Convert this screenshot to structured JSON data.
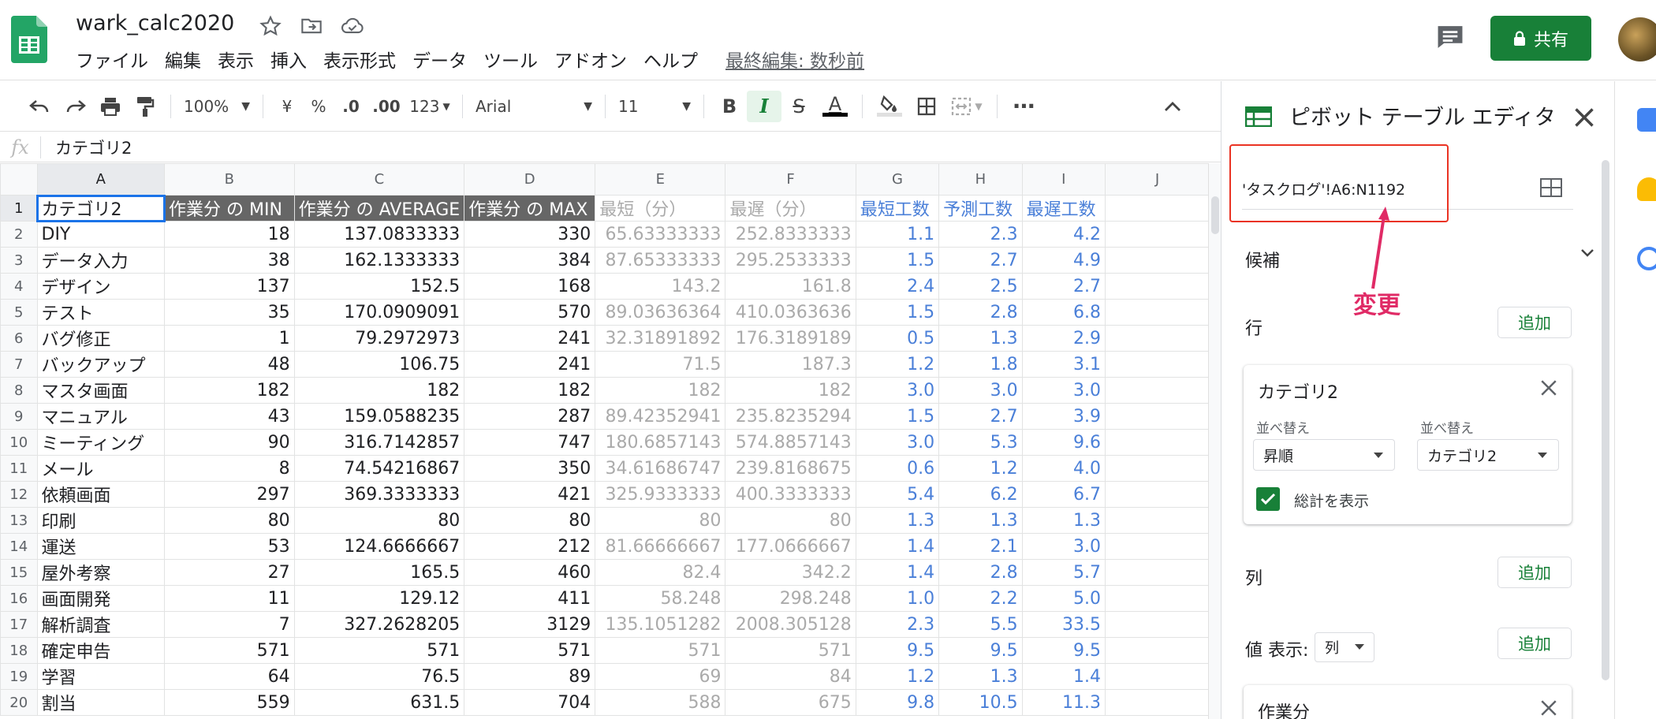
{
  "app": {
    "doc_title": "wark_calc2020",
    "menu": [
      "ファイル",
      "編集",
      "表示",
      "挿入",
      "表示形式",
      "データ",
      "ツール",
      "アドオン",
      "ヘルプ"
    ],
    "last_edit": "最終編集: 数秒前",
    "share_label": "共有"
  },
  "toolbar": {
    "zoom": "100%",
    "currency": "¥",
    "percent": "%",
    "dec_decrease": ".0",
    "dec_increase": ".00",
    "format_more": "123",
    "font": "Arial",
    "font_size": "11",
    "bold": "B",
    "italic": "I",
    "strike": "S",
    "text_color": "A"
  },
  "formula_bar": {
    "fx": "fx",
    "content": "カテゴリ2"
  },
  "sheet": {
    "columns": [
      "A",
      "B",
      "C",
      "D",
      "E",
      "F",
      "G",
      "H",
      "I",
      "J"
    ],
    "header_row": [
      "カテゴリ2",
      "作業分 の MIN",
      "作業分 の AVERAGE",
      "作業分 の MAX",
      "最短（分）",
      "最遅（分）",
      "最短工数",
      "予測工数",
      "最遅工数",
      ""
    ],
    "rows": [
      [
        "DIY",
        "18",
        "137.0833333",
        "330",
        "65.63333333",
        "252.8333333",
        "1.1",
        "2.3",
        "4.2"
      ],
      [
        "データ入力",
        "38",
        "162.1333333",
        "384",
        "87.65333333",
        "295.2533333",
        "1.5",
        "2.7",
        "4.9"
      ],
      [
        "デザイン",
        "137",
        "152.5",
        "168",
        "143.2",
        "161.8",
        "2.4",
        "2.5",
        "2.7"
      ],
      [
        "テスト",
        "35",
        "170.0909091",
        "570",
        "89.03636364",
        "410.0363636",
        "1.5",
        "2.8",
        "6.8"
      ],
      [
        "バグ修正",
        "1",
        "79.2972973",
        "241",
        "32.31891892",
        "176.3189189",
        "0.5",
        "1.3",
        "2.9"
      ],
      [
        "バックアップ",
        "48",
        "106.75",
        "241",
        "71.5",
        "187.3",
        "1.2",
        "1.8",
        "3.1"
      ],
      [
        "マスタ画面",
        "182",
        "182",
        "182",
        "182",
        "182",
        "3.0",
        "3.0",
        "3.0"
      ],
      [
        "マニュアル",
        "43",
        "159.0588235",
        "287",
        "89.42352941",
        "235.8235294",
        "1.5",
        "2.7",
        "3.9"
      ],
      [
        "ミーティング",
        "90",
        "316.7142857",
        "747",
        "180.6857143",
        "574.8857143",
        "3.0",
        "5.3",
        "9.6"
      ],
      [
        "メール",
        "8",
        "74.54216867",
        "350",
        "34.61686747",
        "239.8168675",
        "0.6",
        "1.2",
        "4.0"
      ],
      [
        "依頼画面",
        "297",
        "369.3333333",
        "421",
        "325.9333333",
        "400.3333333",
        "5.4",
        "6.2",
        "6.7"
      ],
      [
        "印刷",
        "80",
        "80",
        "80",
        "80",
        "80",
        "1.3",
        "1.3",
        "1.3"
      ],
      [
        "運送",
        "53",
        "124.6666667",
        "212",
        "81.66666667",
        "177.0666667",
        "1.4",
        "2.1",
        "3.0"
      ],
      [
        "屋外考察",
        "27",
        "165.5",
        "460",
        "82.4",
        "342.2",
        "1.4",
        "2.8",
        "5.7"
      ],
      [
        "画面開発",
        "11",
        "129.12",
        "411",
        "58.248",
        "298.248",
        "1.0",
        "2.2",
        "5.0"
      ],
      [
        "解析調査",
        "7",
        "327.2628205",
        "3129",
        "135.1051282",
        "2008.305128",
        "2.3",
        "5.5",
        "33.5"
      ],
      [
        "確定申告",
        "571",
        "571",
        "571",
        "571",
        "571",
        "9.5",
        "9.5",
        "9.5"
      ],
      [
        "学習",
        "64",
        "76.5",
        "89",
        "69",
        "84",
        "1.2",
        "1.3",
        "1.4"
      ],
      [
        "割当",
        "559",
        "631.5",
        "704",
        "588",
        "675",
        "9.8",
        "10.5",
        "11.3"
      ]
    ]
  },
  "pivot_editor": {
    "title": "ピボット テーブル エディタ",
    "range": "'タスクログ'!A6:N1192",
    "suggestions": "候補",
    "rows_label": "行",
    "add_label": "追加",
    "row_card": {
      "field": "カテゴリ2",
      "sort_order_label": "並べ替え",
      "sort_order_value": "昇順",
      "sort_by_label": "並べ替え",
      "sort_by_value": "カテゴリ2",
      "show_totals": "総計を表示"
    },
    "columns_label": "列",
    "values_label": "値",
    "display_label": "表示:",
    "display_value": "列",
    "value_card_field": "作業分"
  },
  "annotation": {
    "label": "変更",
    "color": "#e02b66",
    "box_color": "#ea3323"
  },
  "colors": {
    "brand_green": "#188038",
    "selection_blue": "#1a73e8",
    "value_blue": "#4a7fd8",
    "header_dark": "#666666"
  }
}
